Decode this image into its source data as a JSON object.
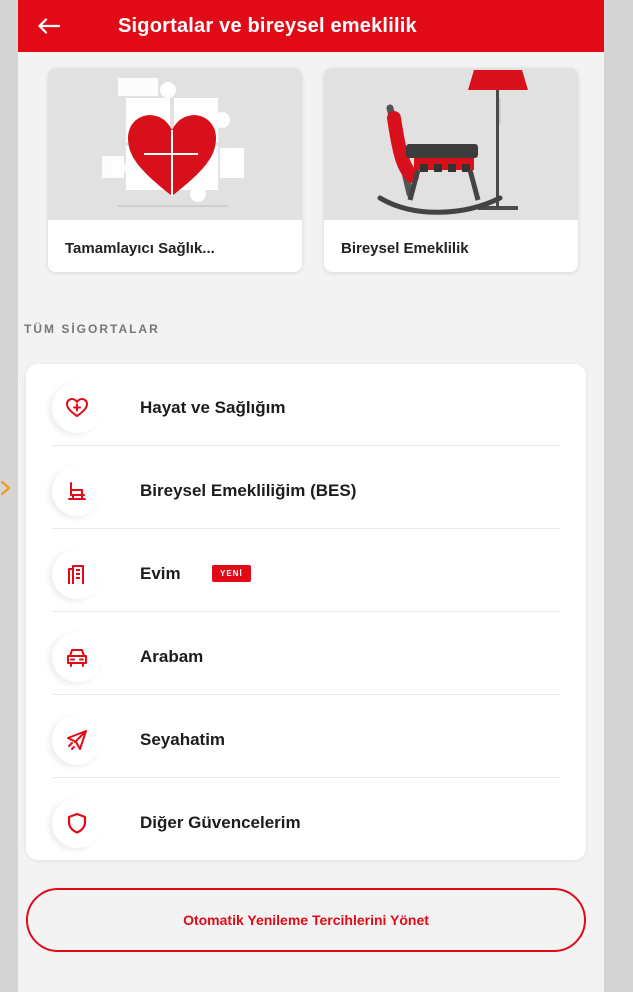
{
  "header": {
    "title": "Sigortalar ve bireysel emeklilik",
    "back_icon": "arrow-left-icon"
  },
  "featured_cards": [
    {
      "label": "Tamamlayıcı Sağlık...",
      "image": "puzzle-heart-illustration"
    },
    {
      "label": "Bireysel Emeklilik",
      "image": "rocking-chair-lamp-illustration"
    }
  ],
  "section_title": "TÜM SİGORTALAR",
  "insurance_list": [
    {
      "label": "Hayat ve Sağlığım",
      "icon": "heart-plus-icon"
    },
    {
      "label": "Bireysel Emekliliğim (BES)",
      "icon": "rocking-chair-icon"
    },
    {
      "label": "Evim",
      "icon": "building-icon",
      "badge": "YENİ"
    },
    {
      "label": "Arabam",
      "icon": "car-icon"
    },
    {
      "label": "Seyahatim",
      "icon": "airplane-icon"
    },
    {
      "label": "Diğer Güvencelerim",
      "icon": "shield-icon"
    }
  ],
  "manage_button": "Otomatik Yenileme Tercihlerini Yönet",
  "colors": {
    "brand_red": "#e30a17",
    "background": "#f3f3f3",
    "text_dark": "#1c1c1c",
    "section_grey": "#777777"
  }
}
